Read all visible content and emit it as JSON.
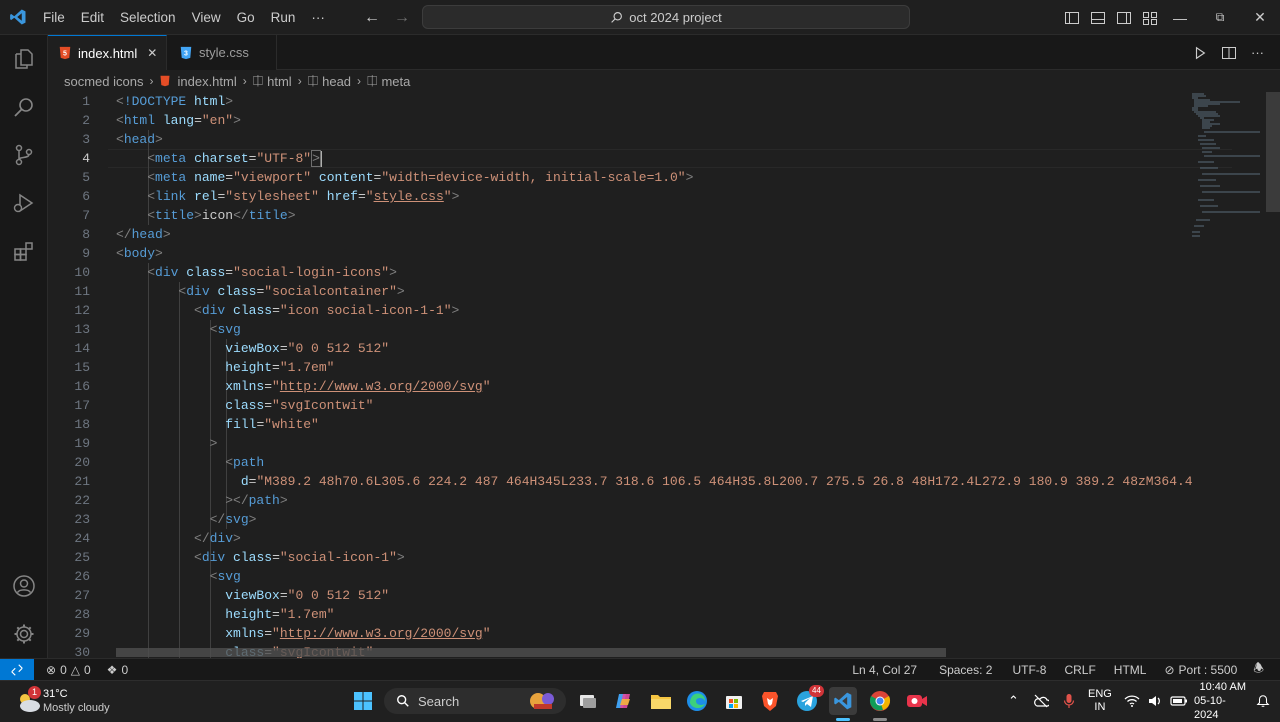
{
  "menu": [
    "File",
    "Edit",
    "Selection",
    "View",
    "Go",
    "Run"
  ],
  "menu_more": "···",
  "search": {
    "text": "oct 2024 project"
  },
  "window": {
    "minimize": "—",
    "maximize": "⧉",
    "close": "✕"
  },
  "tabs": [
    {
      "label": "index.html",
      "badge": "5",
      "close": "✕"
    },
    {
      "label": "style.css",
      "badge": "3"
    }
  ],
  "breadcrumb": [
    "socmed icons",
    "index.html",
    "html",
    "head",
    "meta"
  ],
  "code": {
    "l1": "1",
    "l2": "2",
    "l3": "3",
    "l4": "4",
    "l5": "5",
    "l6": "6",
    "l7": "7",
    "l8": "8",
    "l9": "9",
    "l10": "10",
    "l11": "11",
    "l12": "12",
    "l13": "13",
    "l14": "14",
    "l15": "15",
    "l16": "16",
    "l17": "17",
    "l18": "18",
    "l19": "19",
    "l20": "20",
    "l21": "21",
    "l22": "22",
    "l23": "23",
    "l24": "24",
    "l25": "25",
    "l26": "26",
    "l27": "27",
    "l28": "28",
    "l29": "29",
    "l30": "30",
    "doctype": "!DOCTYPE",
    "html_kw": "html",
    "lang_attr": "lang",
    "lang_val": "\"en\"",
    "head": "head",
    "meta": "meta",
    "charset_attr": "charset",
    "charset_val": "\"UTF-8\"",
    "name_attr": "name",
    "name_val": "\"viewport\"",
    "content_attr": "content",
    "content_val": "\"width=device-width, initial-scale=1.0\"",
    "link": "link",
    "rel_attr": "rel",
    "rel_val": "\"stylesheet\"",
    "href_attr": "href",
    "href_val": "style.css",
    "title": "title",
    "title_text": "icon",
    "body": "body",
    "div": "div",
    "class_attr": "class",
    "class1": "\"social-login-icons\"",
    "class2": "\"socialcontainer\"",
    "class3": "\"icon social-icon-1-1\"",
    "svg": "svg",
    "viewbox_attr": "viewBox",
    "viewbox_val": "\"0 0 512 512\"",
    "height_attr": "height",
    "height_val": "\"1.7em\"",
    "xmlns_attr": "xmlns",
    "xmlns_val": "http://www.w3.org/2000/svg",
    "svgclass_val": "\"svgIcontwit\"",
    "fill_attr": "fill",
    "fill_val": "\"white\"",
    "path": "path",
    "d_attr": "d",
    "d_val": "\"M389.2 48h70.6L305.6 224.2 487 464H345L233.7 318.6 106.5 464H35.8L200.7 275.5 26.8 48H172.4L272.9 180.9 389.2 48zM364.4",
    "class4": "\"social-icon-1\""
  },
  "status": {
    "errors": "0",
    "warnings": "0",
    "ports": "0",
    "position": "Ln 4, Col 27",
    "spaces": "Spaces: 2",
    "encoding": "UTF-8",
    "eol": "CRLF",
    "language": "HTML",
    "port": "Port : 5500"
  },
  "taskbar": {
    "temp": "31°C",
    "weather": "Mostly cloudy",
    "weather_badge": "1",
    "search": "Search",
    "telegram_badge": "44",
    "lang1": "ENG",
    "lang2": "IN",
    "time": "10:40 AM",
    "date": "05-10-2024"
  },
  "colors": {
    "accent": "#0078d4",
    "tag": "#569cd6",
    "attr": "#9cdcfe",
    "string": "#ce9178"
  }
}
